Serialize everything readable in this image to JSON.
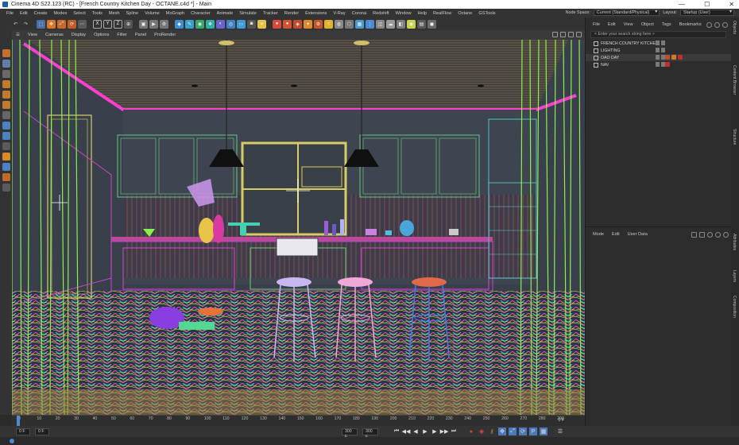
{
  "window": {
    "title": "Cinema 4D S22.123 (RC) - [French Country Kitchen Day - OCTANE.c4d *] - Main"
  },
  "menubar": {
    "items": [
      "File",
      "Edit",
      "Create",
      "Modes",
      "Select",
      "Tools",
      "Mesh",
      "Spline",
      "Volume",
      "MoGraph",
      "Character",
      "Animate",
      "Simulate",
      "Tracker",
      "Render",
      "Extensions",
      "V-Ray",
      "Corona",
      "Redshift",
      "Window",
      "Help",
      "RealFlow",
      "Octane",
      "GSTools"
    ],
    "node_space_label": "Node Space:",
    "node_space_value": "Current (Standard/Physical)",
    "layout_label": "Layout:",
    "layout_value": "Startup (User)"
  },
  "viewport_menu": {
    "items": [
      "View",
      "Cameras",
      "Display",
      "Options",
      "Filter",
      "Panel",
      "ProRender"
    ]
  },
  "object_manager": {
    "menu": [
      "File",
      "Edit",
      "View",
      "Object",
      "Tags",
      "Bookmarks"
    ],
    "search_placeholder": "< Enter your search string here >",
    "objects": [
      {
        "name": "FRENCH COUNTRY KITCHEN"
      },
      {
        "name": "LIGHTING"
      },
      {
        "name": "OAO DAY"
      },
      {
        "name": "NAV"
      }
    ]
  },
  "attribute_manager": {
    "menu": [
      "Mode",
      "Edit",
      "User Data"
    ]
  },
  "right_tabs": [
    "Objects",
    "Content Browser",
    "Structure",
    "Attributes",
    "Layers",
    "Composition"
  ],
  "timeline": {
    "ticks": [
      "0",
      "10",
      "20",
      "30",
      "40",
      "50",
      "60",
      "70",
      "80",
      "90",
      "100",
      "110",
      "120",
      "130",
      "140",
      "150",
      "160",
      "170",
      "180",
      "190",
      "200",
      "210",
      "220",
      "230",
      "240",
      "250",
      "260",
      "270",
      "280",
      "290"
    ],
    "current_frame": "0 F"
  },
  "playback": {
    "start_field": "0 F",
    "start_field2": "0 F",
    "end_field": "300 F",
    "end_field2": "300 F"
  },
  "colors": {
    "ceiling_trim": "#ff3fd2",
    "wireframe_green": "#8cf04a",
    "cabinet_yellow": "#d7cc66"
  }
}
